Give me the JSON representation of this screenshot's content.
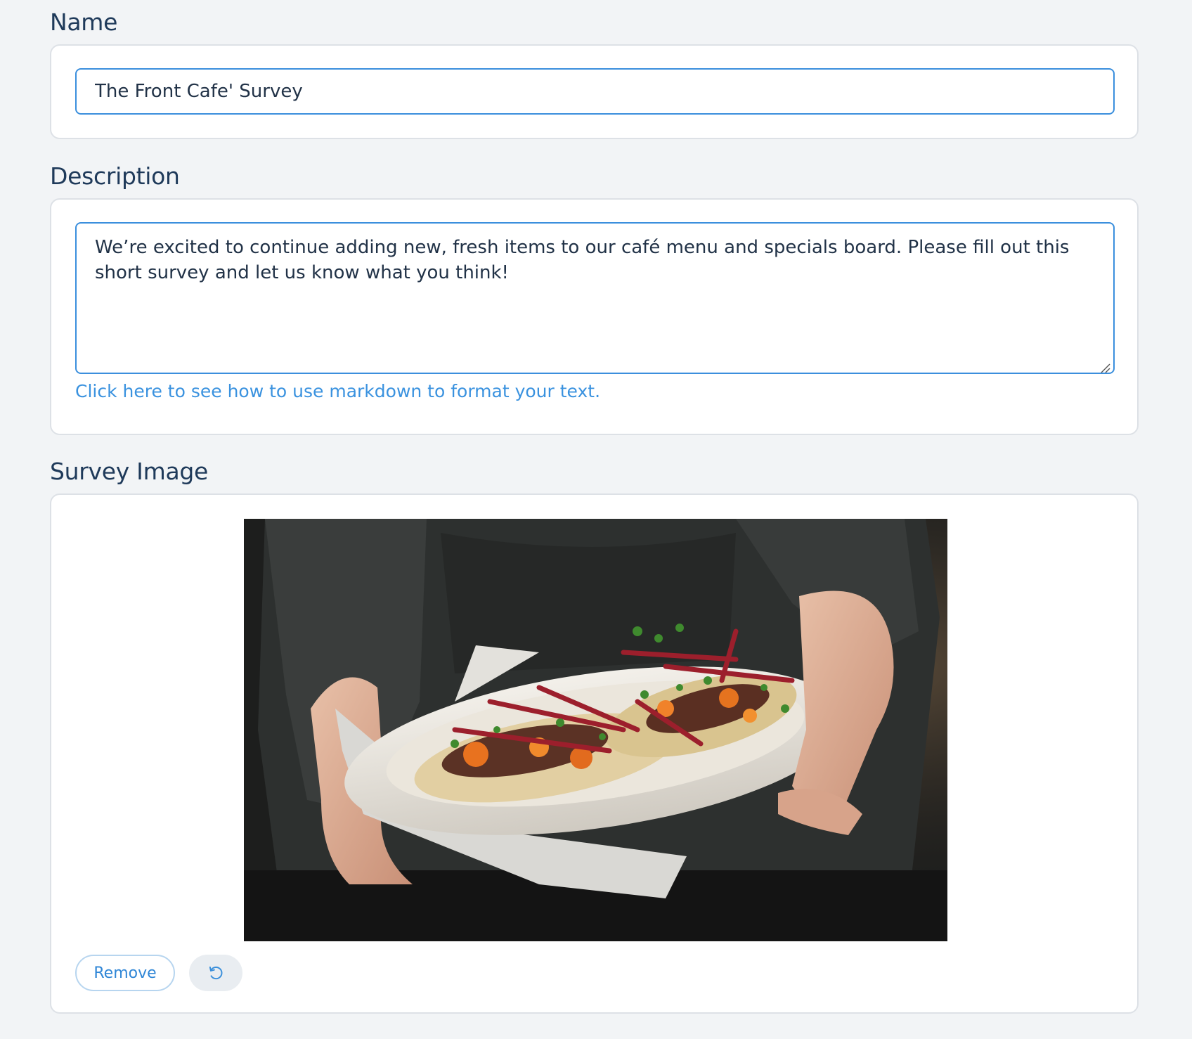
{
  "name_section": {
    "label": "Name",
    "value": "The Front Cafe' Survey"
  },
  "description_section": {
    "label": "Description",
    "value": "We’re excited to continue adding new, fresh items to our café menu and specials board. Please fill out this short survey and let us know what you think!",
    "markdown_link": "Click here to see how to use markdown to format your text."
  },
  "image_section": {
    "label": "Survey Image",
    "remove_label": "Remove",
    "reset_icon": "undo-icon"
  },
  "colors": {
    "accent": "#3b8fdd",
    "label_text": "#1f3a5a",
    "page_bg": "#f2f4f6"
  }
}
